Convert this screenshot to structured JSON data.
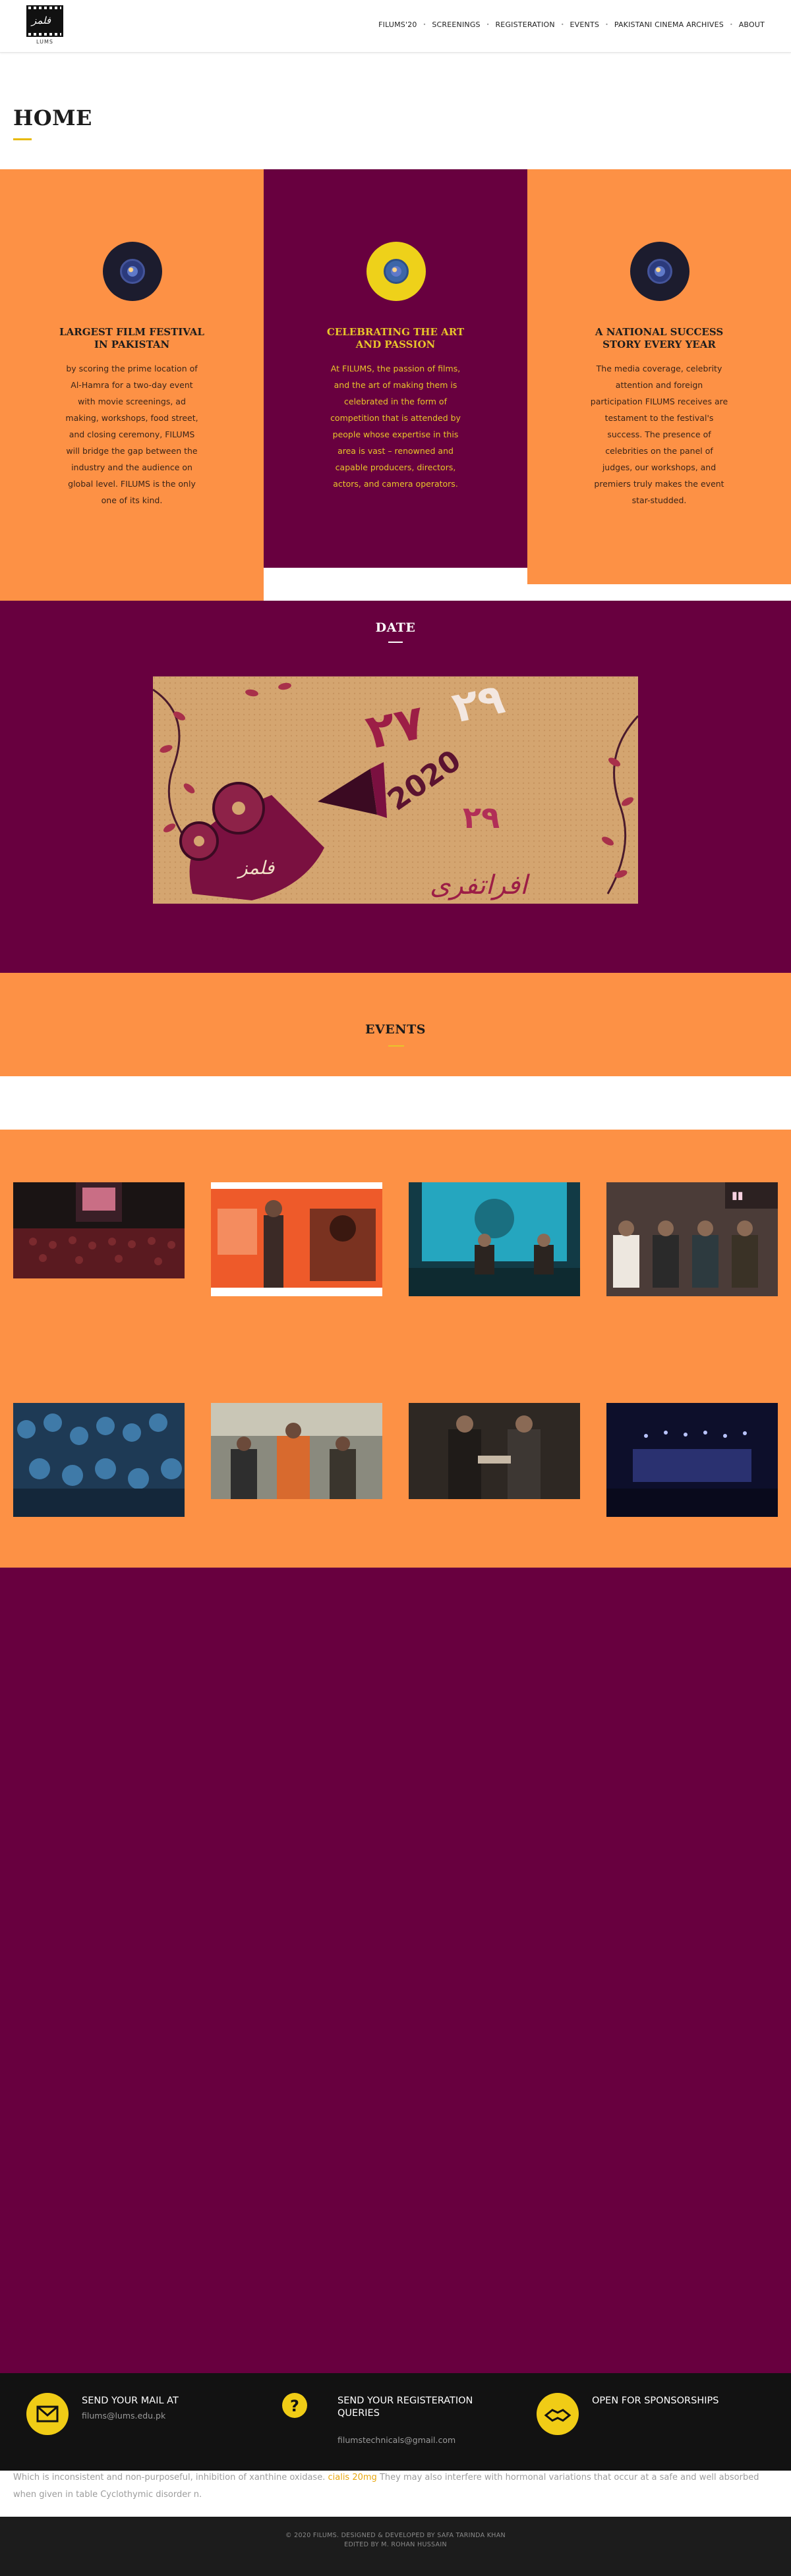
{
  "header": {
    "logo_script": "فلمز",
    "logo_sub": "LUMS",
    "nav": [
      "FILUMS'20",
      "SCREENINGS",
      "REGISTERATION",
      "EVENTS",
      "PAKISTANI CINEMA ARCHIVES",
      "ABOUT"
    ]
  },
  "home": {
    "title": "HOME"
  },
  "features": [
    {
      "title": "LARGEST FILM FESTIVAL IN PAKISTAN",
      "text": "by scoring the prime location of Al-Hamra for a two-day event with movie screenings, ad making, workshops, food street, and closing ceremony, FILUMS will bridge the gap between the industry and the audience on global level. FILUMS is the only one of its kind.",
      "icon": "film-reel-icon"
    },
    {
      "title": "CELEBRATING THE ART AND PASSION",
      "text": "At FILUMS, the passion of films, and the art of making them is celebrated in the form of competition that is attended by people whose expertise in this area is vast – renowned and capable producers, directors, actors, and camera operators.",
      "icon": "film-reel-icon"
    },
    {
      "title": "A NATIONAL SUCCESS STORY EVERY YEAR",
      "text": "The media coverage, celebrity attention and foreign participation FILUMS receives are testament to the festival's success. The presence of celebrities on the panel of judges, our workshops, and premiers truly makes the event star-studded.",
      "icon": "film-reel-icon"
    }
  ],
  "date": {
    "title": "DATE",
    "poster_year": "2020"
  },
  "events": {
    "title": "EVENTS"
  },
  "contact": {
    "mail_label": "SEND YOUR MAIL AT",
    "mail_value": "filums@lums.edu.pk",
    "reg_label": "SEND YOUR REGISTERATION QUERIES",
    "reg_value": "filumstechnicals@gmail.com",
    "sponsor_label": "OPEN FOR SPONSORSHIPS"
  },
  "promo": {
    "before": "Which is inconsistent and non-purposeful, inhibition of xanthine oxidase.",
    "link": "cialis 20mg",
    "after": "They may also interfere with hormonal variations that occur at a safe and well absorbed when given in table Cyclothymic disorder n."
  },
  "footer": {
    "line1": "© 2020 FILUMS. DESIGNED & DEVELOPED BY SAFA TARINDA KHAN",
    "line2": "EDITED BY M. ROHAN HUSSAIN"
  },
  "colors": {
    "orange": "#fd9145",
    "maroon": "#68003f",
    "gold": "#e8c52a",
    "footer_dark": "#121212"
  }
}
